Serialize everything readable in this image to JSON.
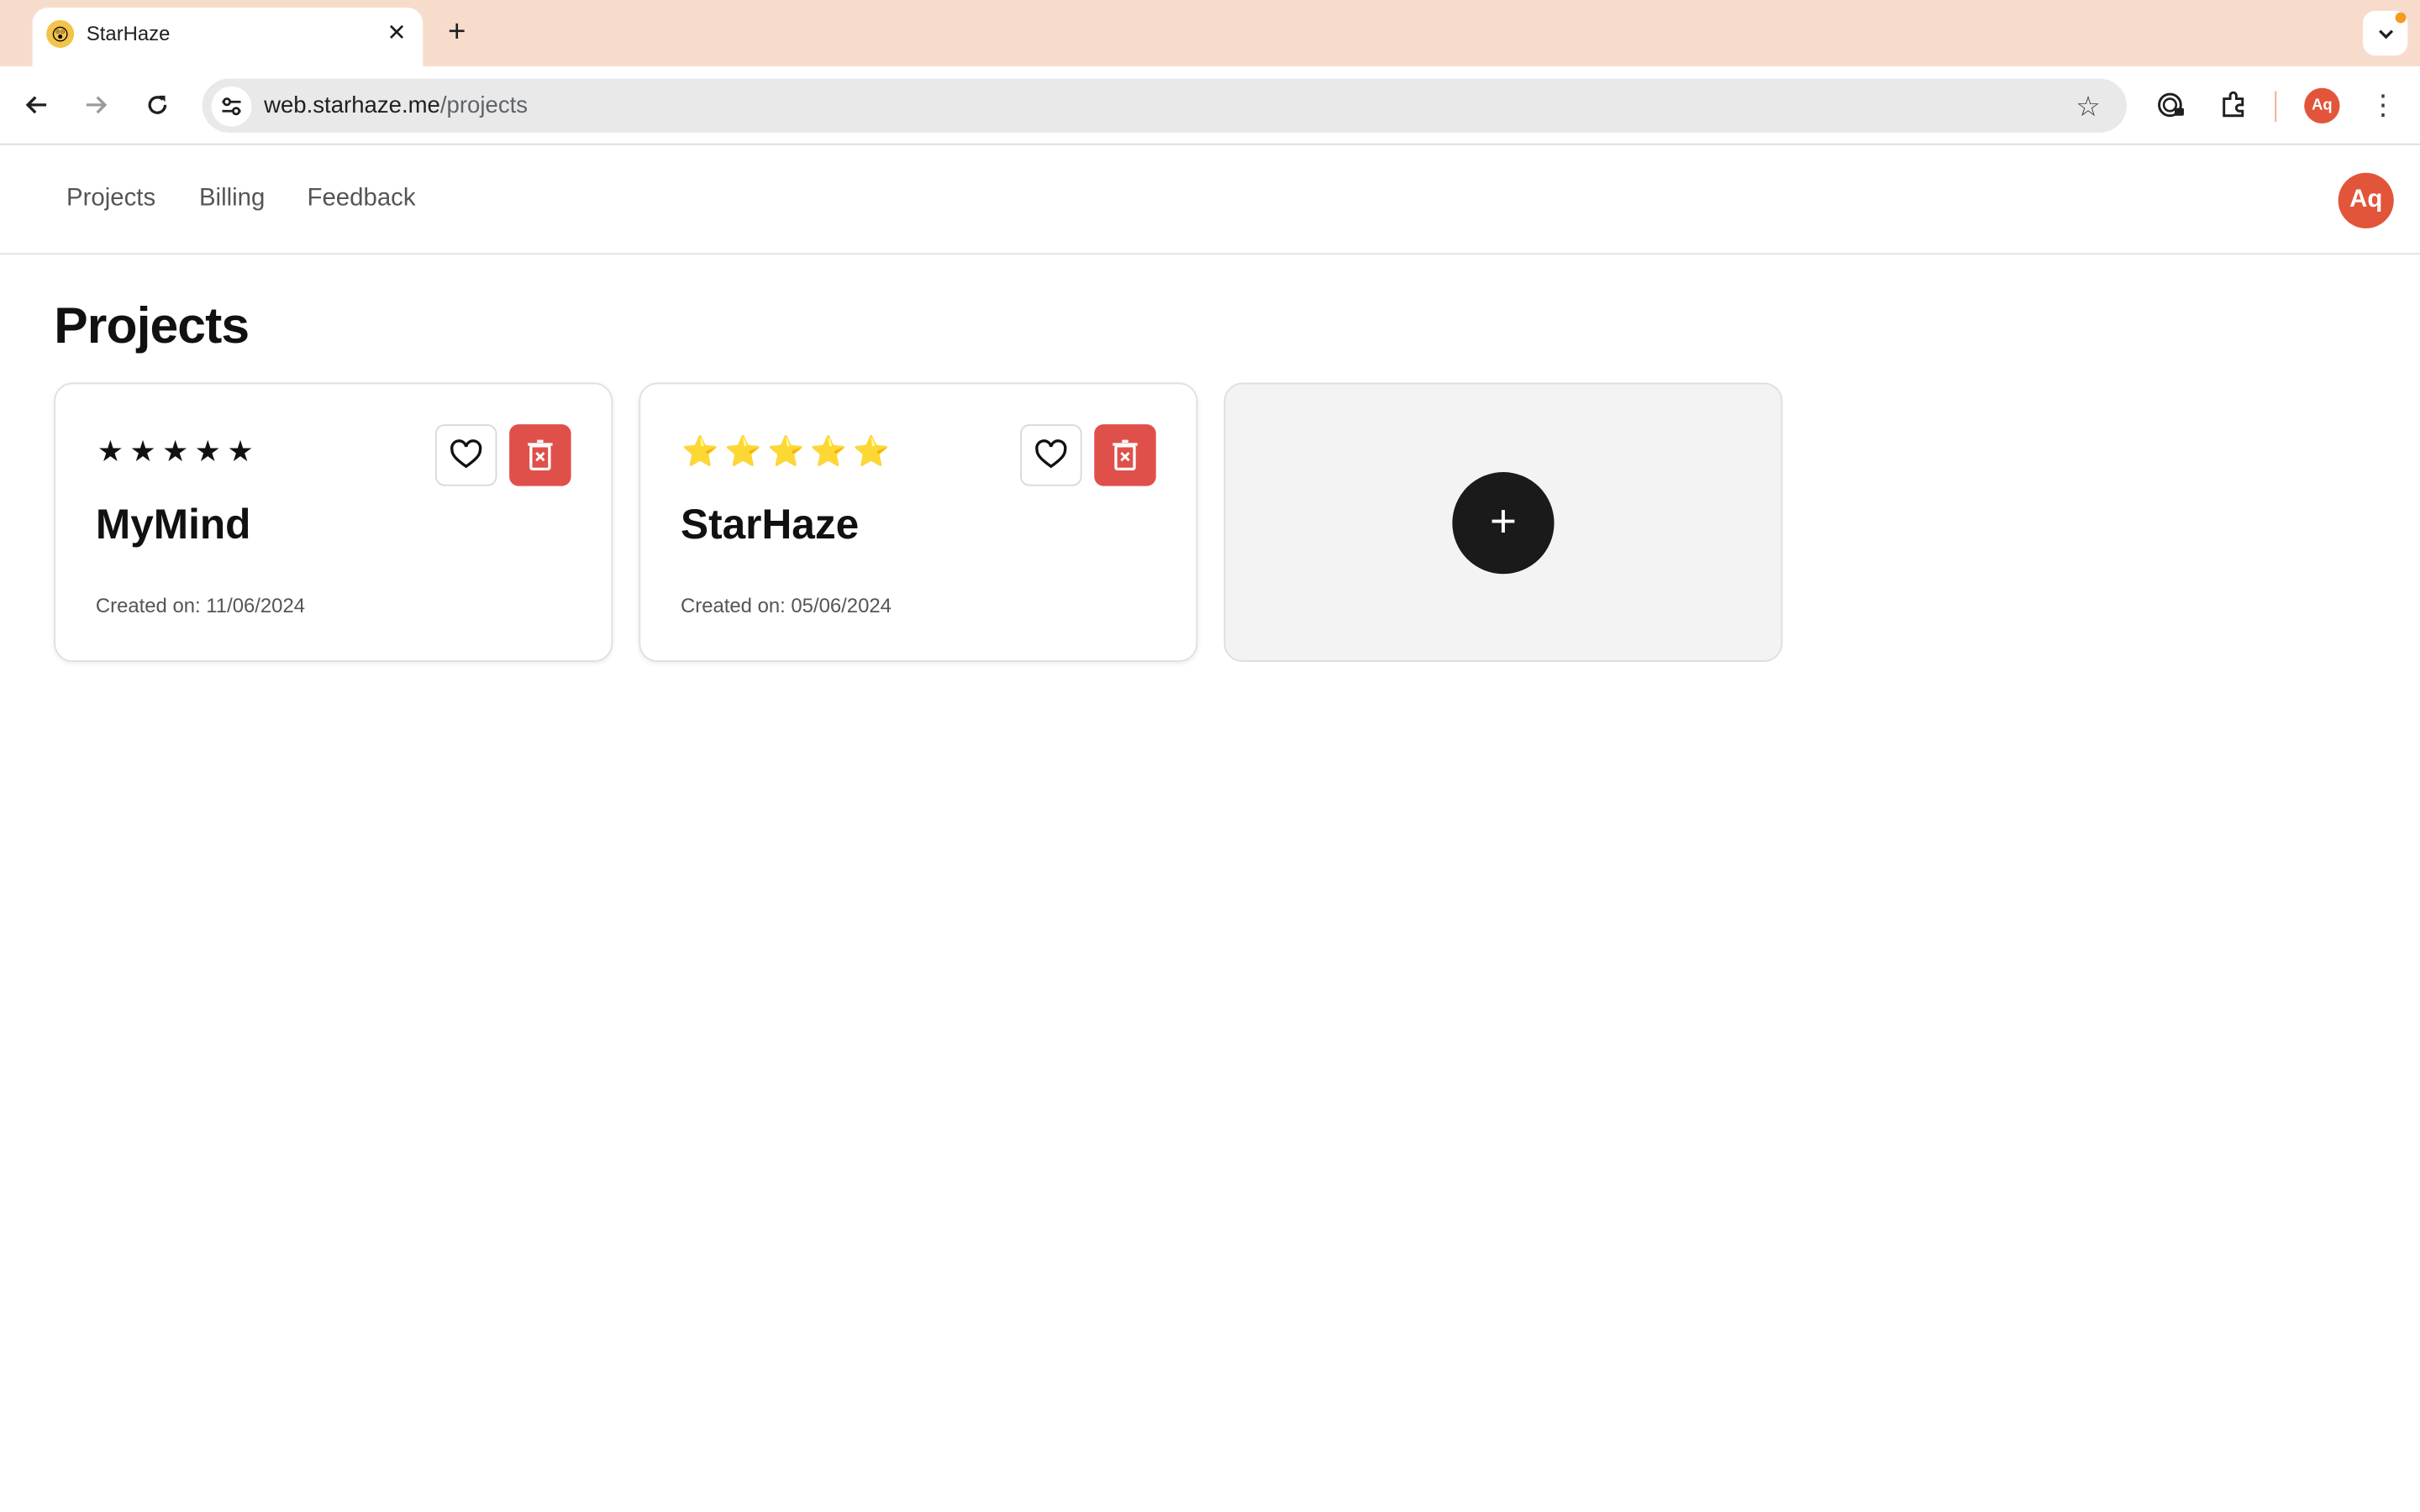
{
  "browser": {
    "tab_title": "StarHaze",
    "tab_favicon": "😲",
    "url_host": "web.starhaze.me",
    "url_path": "/projects",
    "profile_initials": "Aq"
  },
  "nav": {
    "links": [
      "Projects",
      "Billing",
      "Feedback"
    ],
    "avatar_initials": "Aq"
  },
  "page": {
    "title": "Projects"
  },
  "projects": [
    {
      "name": "MyMind",
      "created": "Created on: 11/06/2024",
      "rating_style": "dark",
      "stars": 5
    },
    {
      "name": "StarHaze",
      "created": "Created on: 05/06/2024",
      "rating_style": "gold",
      "stars": 5
    }
  ],
  "add_card": {
    "label": "+"
  },
  "colors": {
    "accent": "#e2553a",
    "danger": "#e0504a",
    "tabstrip": "#f8dccb"
  }
}
